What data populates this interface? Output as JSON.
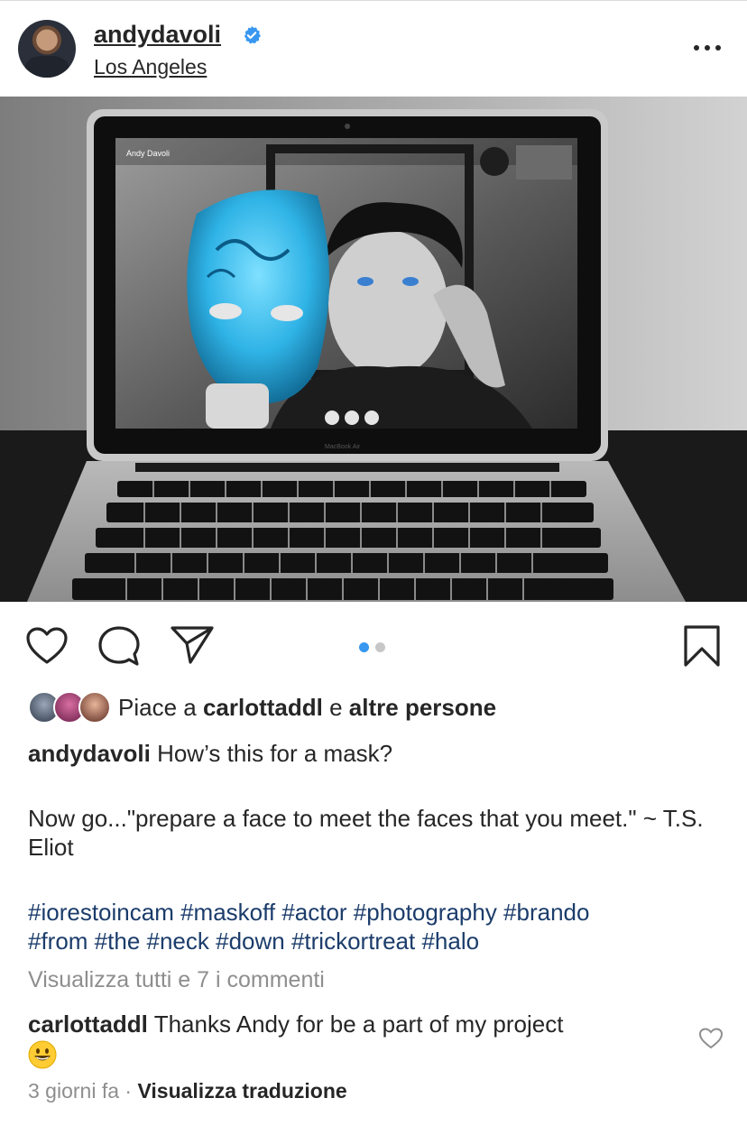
{
  "post": {
    "username": "andydavoli",
    "location": "Los Angeles",
    "verified": true,
    "icons": {
      "more": "more-options-icon",
      "like": "heart-outline-icon",
      "comment": "comment-bubble-icon",
      "share": "paper-plane-icon",
      "save": "bookmark-icon"
    },
    "carousel": {
      "total": 2,
      "active": 1
    },
    "photo_text": {
      "caller_name": "Andy Davoli",
      "laptop_model": "MacBook Air"
    }
  },
  "likes": {
    "prefix": "Piace a ",
    "user": "carlottaddl",
    "middle": " e ",
    "others": "altre persone"
  },
  "caption": {
    "username": "andydavoli",
    "line1": "How’s this for a mask?",
    "line2": "Now go...\"prepare a face to meet the faces that you meet.\" ~ T.S. Eliot",
    "hashtags_line1": "#iorestoincam #maskoff #actor #photography #brando",
    "hashtags_line2": "#from #the #neck #down #trickortreat  #halo"
  },
  "comments": {
    "view_all": "Visualizza tutti e 7 i commenti",
    "items": [
      {
        "username": "carlottaddl",
        "text": "Thanks Andy for be a part of my project",
        "emoji": "grinning-face-emoji"
      }
    ]
  },
  "meta": {
    "time": "3 giorni fa",
    "separator": " · ",
    "translate": "Visualizza traduzione"
  },
  "colors": {
    "text": "#262626",
    "muted": "#8e8e8e",
    "hashtag": "#1b3c6b",
    "verified": "#3897f0",
    "carousel_active": "#3897f0",
    "carousel_inactive": "#c7c7c7"
  }
}
